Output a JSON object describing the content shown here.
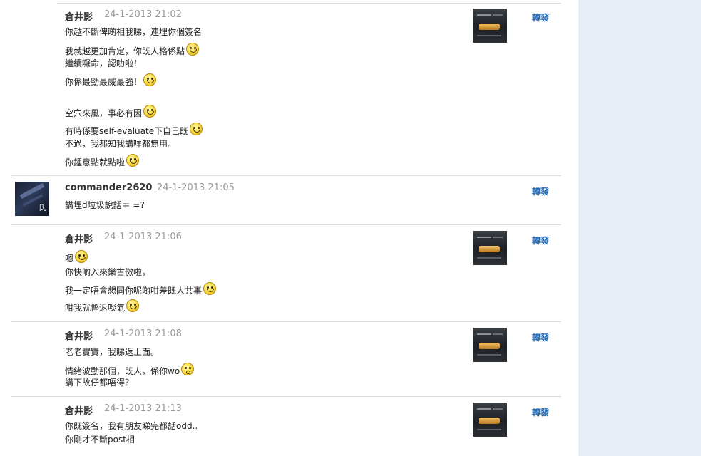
{
  "share_label": "轉發",
  "comments": [
    {
      "author": "倉井影",
      "timestamp": "24-1-2013 21:02",
      "lines": [
        "你越不斷俾啲相我睇，連埋你個簽名",
        "我就越更加肯定，你既人格係點",
        "繼續囉命，認叻啦！",
        "你係最勁最威最強！",
        "空穴來風，事必有因",
        "有時係要self-evaluate下自己既",
        "不過，我都知我講咩都無用。",
        "你鍾意點就點啦"
      ]
    },
    {
      "author": "commander2620",
      "timestamp": "24-1-2013 21:05",
      "lines": [
        "講埋d垃圾說話＝ =?"
      ]
    },
    {
      "author": "倉井影",
      "timestamp": "24-1-2013 21:06",
      "lines": [
        "嗯",
        "你快啲入來樂古傚啦，",
        "我一定唔會想同你呢啲咁差既人共事",
        "咁我就慳返啖氣"
      ]
    },
    {
      "author": "倉井影",
      "timestamp": "24-1-2013 21:08",
      "lines": [
        "老老實實，我睇返上面。",
        "情緒波動那個，既人，係你wo",
        "講下故仔都唔得？"
      ]
    },
    {
      "author": "倉井影",
      "timestamp": "24-1-2013 21:13",
      "lines": [
        "你既簽名，我有朋友睇完都話odd..",
        "你剛才不斷post相"
      ]
    }
  ],
  "icons": {
    "smiley": "smiley-emoticon-icon",
    "dazed": "dazed-emoticon-icon"
  }
}
